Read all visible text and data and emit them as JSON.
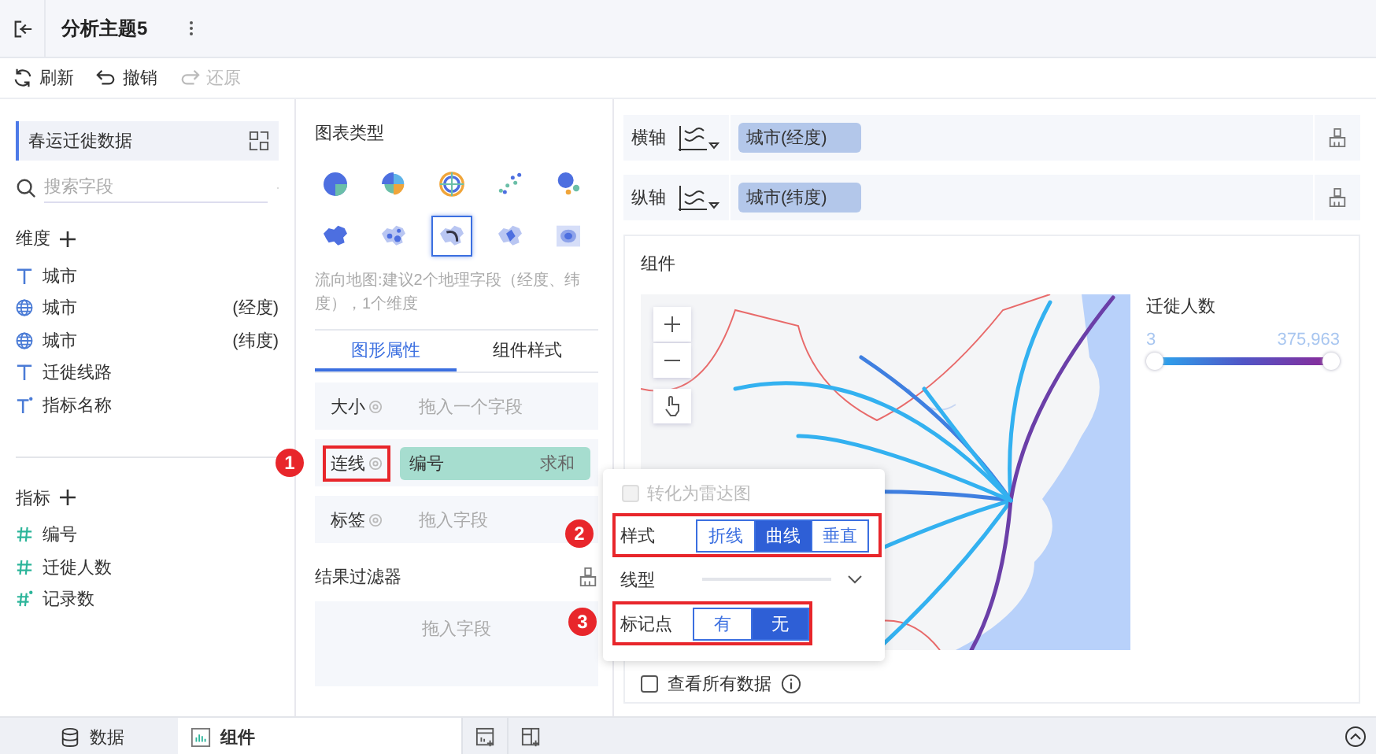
{
  "header": {
    "title": "分析主题5"
  },
  "toolbar": [
    {
      "label": "刷新",
      "disabled": false
    },
    {
      "label": "撤销",
      "disabled": false
    },
    {
      "label": "还原",
      "disabled": true
    }
  ],
  "dataset": {
    "name": "春运迁徙数据"
  },
  "search": {
    "placeholder": "搜索字段"
  },
  "dimensions": {
    "title": "维度",
    "items": [
      {
        "kind": "text",
        "name": "城市"
      },
      {
        "kind": "geo",
        "name": "城市",
        "suffix": "(经度)"
      },
      {
        "kind": "geo",
        "name": "城市",
        "suffix": "(纬度)"
      },
      {
        "kind": "text",
        "name": "迁徙线路"
      },
      {
        "kind": "calc-text",
        "name": "指标名称"
      }
    ]
  },
  "measures": {
    "title": "指标",
    "items": [
      {
        "kind": "number",
        "name": "编号"
      },
      {
        "kind": "number",
        "name": "迁徙人数"
      },
      {
        "kind": "calc-number",
        "name": "记录数"
      }
    ]
  },
  "chart_types": {
    "title": "图表类型",
    "items": [
      {
        "selected": false
      },
      {
        "selected": false
      },
      {
        "selected": false
      },
      {
        "selected": false
      },
      {
        "selected": false
      },
      {
        "selected": false
      },
      {
        "selected": false
      },
      {
        "selected": true
      },
      {
        "selected": false
      },
      {
        "selected": false
      }
    ],
    "hint": "流向地图:建议2个地理字段（经度、纬度），1个维度"
  },
  "tabs": [
    {
      "label": "图形属性",
      "selected": true
    },
    {
      "label": "组件样式",
      "selected": false
    }
  ],
  "properties": [
    {
      "label": "大小",
      "placeholder": "拖入一个字段"
    },
    {
      "label": "连线",
      "field": "编号",
      "aggregate": "求和",
      "annotation": "1"
    },
    {
      "label": "标签",
      "placeholder": "拖入字段"
    }
  ],
  "filter": {
    "title": "结果过滤器",
    "placeholder": "拖入字段"
  },
  "axes": [
    {
      "label": "横轴",
      "field": "城市(经度)"
    },
    {
      "label": "纵轴",
      "field": "城市(纬度)"
    }
  ],
  "component": {
    "title": "组件",
    "legend": {
      "title": "迁徙人数",
      "min": "3",
      "max": "375,963"
    },
    "show_all": {
      "label": "查看所有数据",
      "checked": false
    }
  },
  "popup": {
    "radar": {
      "label": "转化为雷达图",
      "checked": false,
      "disabled": true
    },
    "style": {
      "label": "样式",
      "annotation": "2",
      "options": [
        {
          "label": "折线",
          "selected": false
        },
        {
          "label": "曲线",
          "selected": true
        },
        {
          "label": "垂直",
          "selected": false
        }
      ]
    },
    "line_type": {
      "label": "线型"
    },
    "markers": {
      "label": "标记点",
      "annotation": "3",
      "options": [
        {
          "label": "有",
          "selected": false
        },
        {
          "label": "无",
          "selected": true
        }
      ]
    }
  },
  "bottom_tabs": [
    {
      "label": "数据",
      "selected": false
    },
    {
      "label": "组件",
      "selected": true
    }
  ]
}
